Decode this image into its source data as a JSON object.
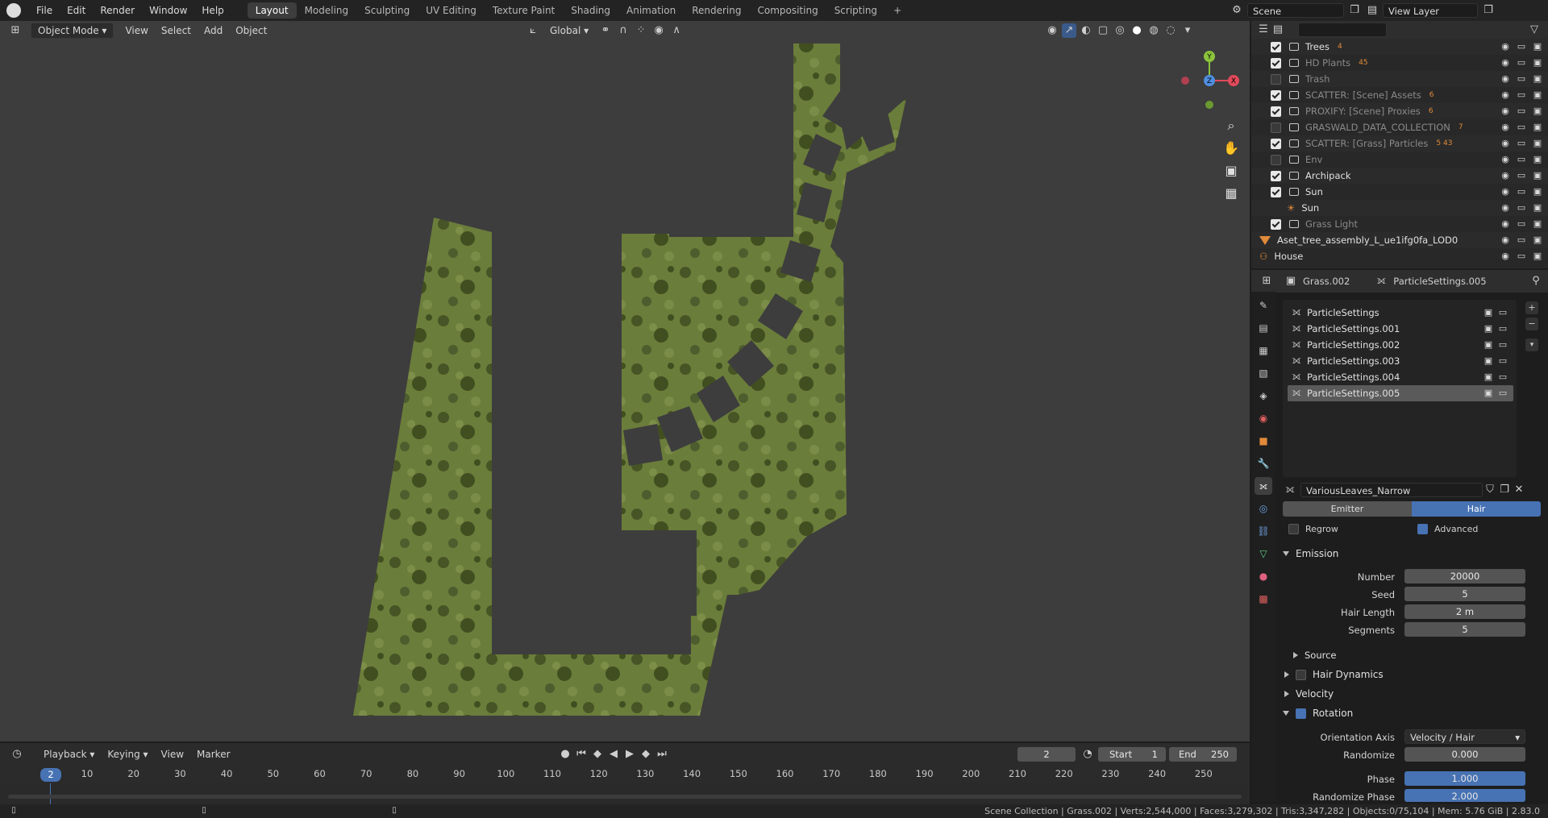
{
  "menu": [
    "File",
    "Edit",
    "Render",
    "Window",
    "Help"
  ],
  "workspaces": [
    "Layout",
    "Modeling",
    "Sculpting",
    "UV Editing",
    "Texture Paint",
    "Shading",
    "Animation",
    "Rendering",
    "Compositing",
    "Scripting"
  ],
  "active_workspace": "Layout",
  "add_workspace": "+",
  "scene": {
    "label": "Scene"
  },
  "view_layer": {
    "label": "View Layer"
  },
  "viewport": {
    "mode": "Object Mode",
    "menus": [
      "View",
      "Select",
      "Add",
      "Object"
    ],
    "orientation": "Global",
    "gizmo": {
      "y": "Y",
      "z": "Z",
      "x": "X"
    },
    "grass_color": "#6b7d3a",
    "bg_color": "#3d3d3d"
  },
  "outliner": {
    "search_placeholder": "",
    "rows": [
      {
        "name": "Trees",
        "checked": true,
        "badge": "4",
        "dim": false
      },
      {
        "name": "HD Plants",
        "checked": true,
        "badge": "45",
        "dim": true
      },
      {
        "name": "Trash",
        "checked": false,
        "badge": "",
        "dim": true
      },
      {
        "name": "SCATTER: [Scene] Assets",
        "checked": true,
        "badge": "6",
        "dim": true
      },
      {
        "name": "PROXIFY: [Scene] Proxies",
        "checked": true,
        "badge": "6",
        "dim": true
      },
      {
        "name": "GRASWALD_DATA_COLLECTION",
        "checked": false,
        "badge": "7",
        "dim": true
      },
      {
        "name": "SCATTER: [Grass] Particles",
        "checked": true,
        "badge": "5 43",
        "dim": true
      },
      {
        "name": "Env",
        "checked": false,
        "badge": "",
        "dim": true
      },
      {
        "name": "Archipack",
        "checked": true,
        "badge": "",
        "dim": false
      },
      {
        "name": "Sun",
        "checked": true,
        "badge": "",
        "dim": false
      },
      {
        "name": "Sun",
        "checked": null,
        "badge": "",
        "dim": false
      },
      {
        "name": "Grass Light",
        "checked": true,
        "badge": "",
        "dim": true
      },
      {
        "name": "Aset_tree_assembly_L_ue1ifg0fa_LOD0",
        "checked": null,
        "badge": "",
        "dim": false
      },
      {
        "name": "House",
        "checked": null,
        "badge": "",
        "dim": false
      }
    ]
  },
  "properties": {
    "object": "Grass.002",
    "settings": "ParticleSettings.005",
    "particle_list": [
      "ParticleSettings",
      "ParticleSettings.001",
      "ParticleSettings.002",
      "ParticleSettings.003",
      "ParticleSettings.004",
      "ParticleSettings.005"
    ],
    "selected_index": 5,
    "datablock": "VariousLeaves_Narrow",
    "type_tabs": [
      "Emitter",
      "Hair"
    ],
    "active_type": "Hair",
    "regrow": {
      "label": "Regrow",
      "checked": false
    },
    "advanced": {
      "label": "Advanced",
      "checked": true
    },
    "emission": {
      "title": "Emission",
      "fields": [
        {
          "label": "Number",
          "value": "20000"
        },
        {
          "label": "Seed",
          "value": "5"
        },
        {
          "label": "Hair Length",
          "value": "2 m"
        },
        {
          "label": "Segments",
          "value": "5"
        }
      ]
    },
    "source": "Source",
    "hair_dynamics": "Hair Dynamics",
    "velocity": "Velocity",
    "rotation": {
      "title": "Rotation",
      "orientation_axis": {
        "label": "Orientation Axis",
        "value": "Velocity / Hair"
      },
      "randomize": {
        "label": "Randomize",
        "value": "0.000"
      },
      "phase": {
        "label": "Phase",
        "value": "1.000"
      },
      "randomize_phase": {
        "label": "Randomize Phase",
        "value": "2.000"
      }
    }
  },
  "timeline": {
    "menus": [
      "Playback",
      "Keying",
      "View",
      "Marker"
    ],
    "current_frame": "2",
    "start_label": "Start",
    "start": "1",
    "end_label": "End",
    "end": "250",
    "ticks": [
      "10",
      "20",
      "30",
      "40",
      "50",
      "60",
      "70",
      "80",
      "90",
      "100",
      "110",
      "120",
      "130",
      "140",
      "150",
      "160",
      "170",
      "180",
      "190",
      "200",
      "210",
      "220",
      "230",
      "240",
      "250"
    ],
    "playhead": "2"
  },
  "status": "Scene Collection | Grass.002 | Verts:2,544,000 | Faces:3,279,302 | Tris:3,347,282 | Objects:0/75,104 | Mem: 5.76 GiB | 2.83.0"
}
